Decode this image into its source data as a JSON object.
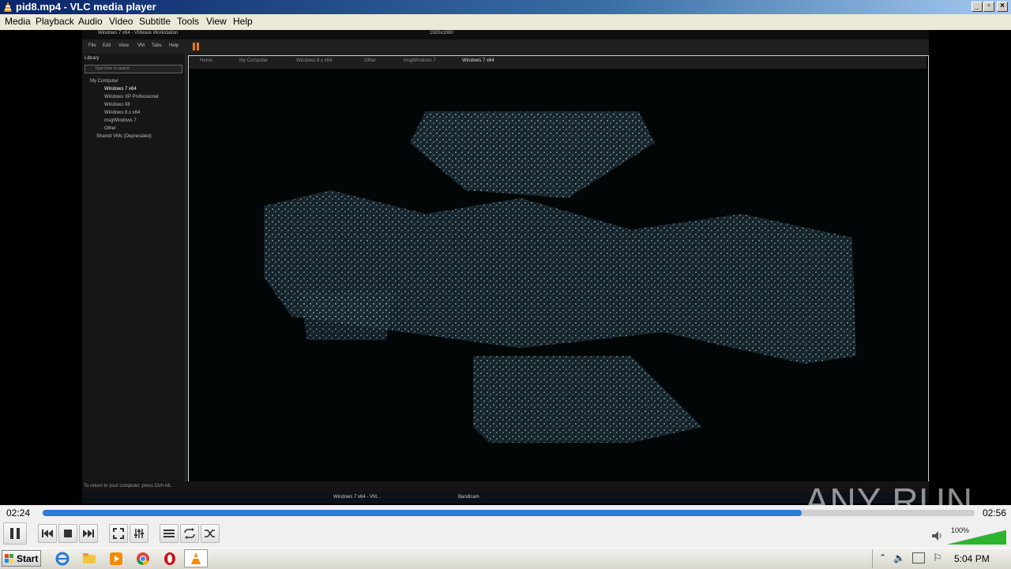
{
  "window": {
    "title": "pid8.mp4 - VLC media player",
    "buttons": [
      "_",
      "▫",
      "×"
    ]
  },
  "menu": [
    "Media",
    "Playback",
    "Audio",
    "Video",
    "Subtitle",
    "Tools",
    "View",
    "Help"
  ],
  "vmware": {
    "title": "Windows 7 x64 - VMware Workstation",
    "menu": [
      "File",
      "Edit",
      "View",
      "VM",
      "Tabs",
      "Help"
    ],
    "resolution": "1920x1080",
    "library_label": "Library",
    "search_placeholder": "Type here to search",
    "tree": [
      "My Computer",
      "Windows 7 x64",
      "Windows XP Professional",
      "Windows 98",
      "Windows 8.x x64",
      "msgWindows 7",
      "Other",
      "Shared VMs (Deprecated)"
    ],
    "tabs": [
      "Home",
      "My Computer",
      "Windows 8.x x64",
      "Other",
      "msgWindows 7",
      "Windows 7 x64"
    ],
    "status": "To return to your computer, press Ctrl+Alt.",
    "guest_taskbar": [
      "Windows 7 x64 - VM...",
      "Bandicam"
    ]
  },
  "watermark": "ANY RUN",
  "playback": {
    "elapsed": "02:24",
    "total": "02:56",
    "progress": 0.814
  },
  "controls": {
    "icons": [
      "pause-icon",
      "previous-icon",
      "stop-icon",
      "next-icon",
      "fullscreen-icon",
      "extended-settings-icon",
      "playlist-icon",
      "loop-icon",
      "shuffle-icon"
    ],
    "volume": "100%",
    "volume_level": 1.0
  },
  "taskbar": {
    "start_label": "Start",
    "time": "5:04 PM"
  },
  "colors": {
    "title_gradient_start": "#0a246a",
    "seek_fill": "#2b7bd8",
    "volume_green": "#2cb52c"
  }
}
